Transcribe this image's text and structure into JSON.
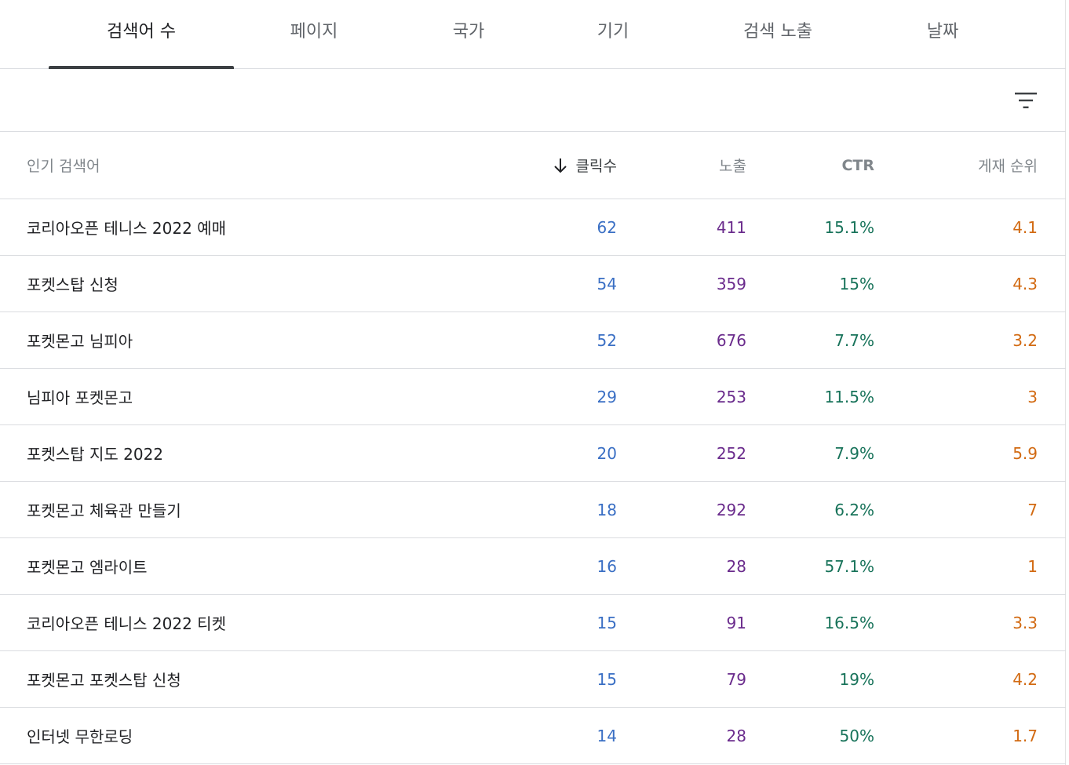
{
  "tabs": [
    {
      "label": "검색어 수",
      "active": true
    },
    {
      "label": "페이지",
      "active": false
    },
    {
      "label": "국가",
      "active": false
    },
    {
      "label": "기기",
      "active": false
    },
    {
      "label": "검색 노출",
      "active": false
    },
    {
      "label": "날짜",
      "active": false
    }
  ],
  "toolbar": {
    "filter_icon": "filter-list-icon"
  },
  "table": {
    "headers": {
      "query": "인기 검색어",
      "clicks": "클릭수",
      "impressions": "노출",
      "ctr": "CTR",
      "position": "게재 순위"
    },
    "sort": {
      "column": "clicks",
      "direction": "desc",
      "icon": "arrow-down-icon"
    },
    "rows": [
      {
        "query": "코리아오픈 테니스 2022 예매",
        "clicks": "62",
        "impressions": "411",
        "ctr": "15.1%",
        "position": "4.1"
      },
      {
        "query": "포켓스탑 신청",
        "clicks": "54",
        "impressions": "359",
        "ctr": "15%",
        "position": "4.3"
      },
      {
        "query": "포켓몬고 님피아",
        "clicks": "52",
        "impressions": "676",
        "ctr": "7.7%",
        "position": "3.2"
      },
      {
        "query": "님피아 포켓몬고",
        "clicks": "29",
        "impressions": "253",
        "ctr": "11.5%",
        "position": "3"
      },
      {
        "query": "포켓스탑 지도 2022",
        "clicks": "20",
        "impressions": "252",
        "ctr": "7.9%",
        "position": "5.9"
      },
      {
        "query": "포켓몬고 체육관 만들기",
        "clicks": "18",
        "impressions": "292",
        "ctr": "6.2%",
        "position": "7"
      },
      {
        "query": "포켓몬고 엠라이트",
        "clicks": "16",
        "impressions": "28",
        "ctr": "57.1%",
        "position": "1"
      },
      {
        "query": "코리아오픈 테니스 2022 티켓",
        "clicks": "15",
        "impressions": "91",
        "ctr": "16.5%",
        "position": "3.3"
      },
      {
        "query": "포켓몬고 포켓스탑 신청",
        "clicks": "15",
        "impressions": "79",
        "ctr": "19%",
        "position": "4.2"
      },
      {
        "query": "인터넷 무한로딩",
        "clicks": "14",
        "impressions": "28",
        "ctr": "50%",
        "position": "1.7"
      }
    ]
  },
  "colors": {
    "clicks": "#3a6fc4",
    "impressions": "#6a2b8c",
    "ctr": "#18735a",
    "position": "#d26a12",
    "active_tab_underline": "#3c4043",
    "divider": "#dadce0"
  }
}
